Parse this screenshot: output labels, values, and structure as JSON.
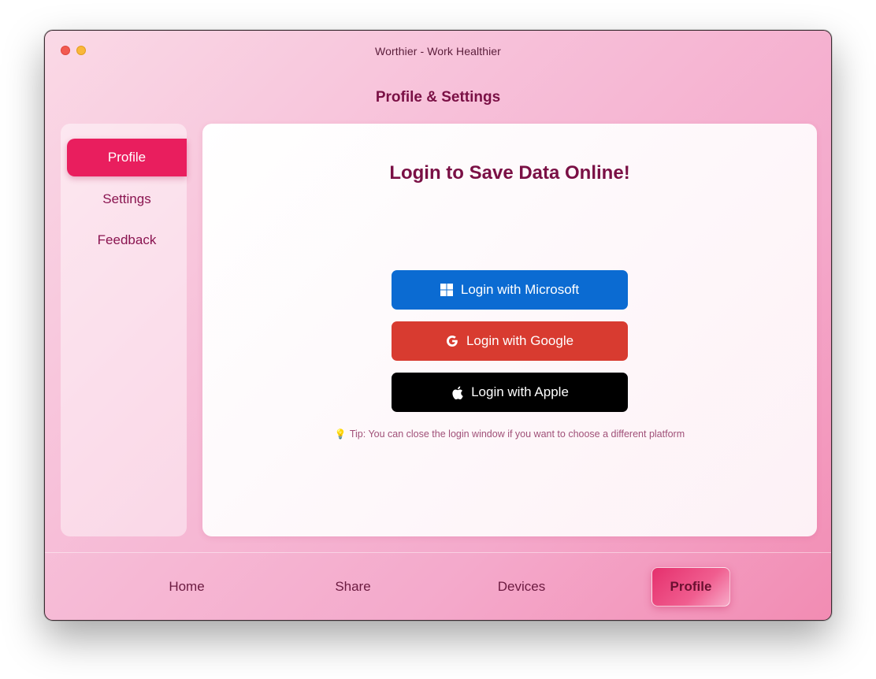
{
  "window": {
    "title": "Worthier - Work Healthier"
  },
  "page": {
    "title": "Profile & Settings"
  },
  "sidebar": {
    "items": [
      {
        "label": "Profile",
        "active": true
      },
      {
        "label": "Settings",
        "active": false
      },
      {
        "label": "Feedback",
        "active": false
      }
    ]
  },
  "login": {
    "heading": "Login to Save Data Online!",
    "buttons": {
      "microsoft": {
        "label": "Login with Microsoft",
        "icon": "windows-icon",
        "color": "#0b6bd2"
      },
      "google": {
        "label": "Login with Google",
        "icon": "google-icon",
        "color": "#d83b30"
      },
      "apple": {
        "label": "Login with Apple",
        "icon": "apple-icon",
        "color": "#000000"
      }
    },
    "tip": {
      "icon": "lightbulb-icon",
      "text": "Tip: You can close the login window if you want to choose a different platform"
    }
  },
  "bottom_nav": {
    "items": [
      {
        "label": "Home",
        "active": false
      },
      {
        "label": "Share",
        "active": false
      },
      {
        "label": "Devices",
        "active": false
      },
      {
        "label": "Profile",
        "active": true
      }
    ]
  },
  "colors": {
    "accent": "#e91e5e",
    "heading": "#7a1045"
  }
}
